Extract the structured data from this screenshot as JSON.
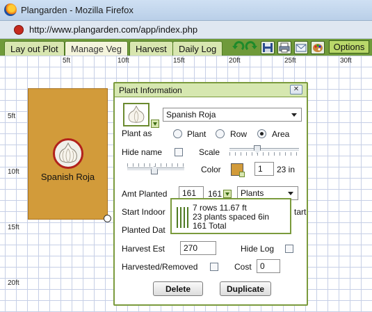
{
  "window": {
    "title": "Plangarden - Mozilla Firefox",
    "url": "http://www.plangarden.com/app/index.php"
  },
  "tabs": [
    {
      "label": "Lay out Plot"
    },
    {
      "label": "Manage Veg"
    },
    {
      "label": "Harvest"
    },
    {
      "label": "Daily Log"
    }
  ],
  "toolbar": {
    "options_label": "Options",
    "icons": [
      "undo-icon",
      "redo-icon",
      "save-icon",
      "print-icon",
      "email-icon",
      "palette-icon"
    ]
  },
  "grid": {
    "x_labels": [
      "5ft",
      "10ft",
      "15ft",
      "20ft",
      "25ft",
      "30ft"
    ],
    "y_labels": [
      "5ft",
      "10ft",
      "15ft",
      "20ft"
    ]
  },
  "plot": {
    "label": "Spanish Roja",
    "icon": "garlic-icon"
  },
  "dialog": {
    "title": "Plant Information",
    "plant_select": "Spanish Roja",
    "plant_as_label": "Plant as",
    "plant_as_options": [
      "Plant",
      "Row",
      "Area"
    ],
    "plant_as_selected": "Area",
    "hide_name_label": "Hide name",
    "scale_label": "Scale",
    "color_label": "Color",
    "color_value": "#d29b3a",
    "size_value": "1",
    "size_unit": "23 in",
    "amt_planted_label": "Amt Planted",
    "amt_planted_value": "161",
    "amt_dropdown_value": "161",
    "amt_unit_select": "Plants",
    "start_indoor_label": "Start Indoor",
    "start_label_fragment": "tart",
    "planted_date_label": "Planted Dat",
    "harvest_est_label": "Harvest Est",
    "harvest_est_value": "270",
    "hide_log_label": "Hide Log",
    "harvested_removed_label": "Harvested/Removed",
    "cost_label": "Cost",
    "cost_value": "0",
    "delete_label": "Delete",
    "duplicate_label": "Duplicate"
  },
  "tooltip": {
    "line1": "7 rows 11.67 ft",
    "line2": "23 plants spaced 6in",
    "line3": "161 Total"
  }
}
